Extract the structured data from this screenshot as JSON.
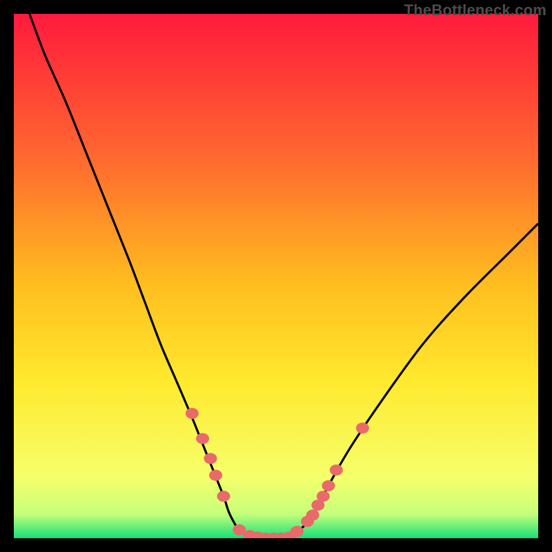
{
  "watermark": "TheBottleneck.com",
  "colors": {
    "top": "#ff1a3c",
    "mid1": "#ff6a2f",
    "mid2": "#ffbf1f",
    "mid3": "#ffe92e",
    "low": "#f6ff6a",
    "band_top": "#caff7a",
    "band_bottom": "#17e07a",
    "curve": "#000000",
    "dot_fill": "#e86a6a",
    "dot_stroke": "#c24848"
  },
  "chart_data": {
    "type": "line",
    "title": "",
    "xlabel": "",
    "ylabel": "",
    "xlim": [
      0,
      100
    ],
    "ylim": [
      0,
      100
    ],
    "series": [
      {
        "name": "bottleneck-curve",
        "x": [
          3,
          6,
          10,
          14,
          18,
          22,
          25,
          28,
          31,
          34,
          36,
          38,
          40,
          41,
          42,
          43,
          45,
          48,
          51,
          53,
          54,
          56,
          58,
          60,
          64,
          70,
          78,
          86,
          94,
          100
        ],
        "y": [
          100,
          92,
          83,
          73,
          63,
          53,
          45,
          37,
          30,
          23,
          18,
          13,
          8,
          5,
          3,
          1.5,
          0.4,
          0,
          0,
          0.3,
          1.2,
          3,
          6,
          10,
          17,
          26,
          37,
          46,
          54,
          60
        ]
      }
    ],
    "points": [
      {
        "x": 34.0,
        "y": 23.8
      },
      {
        "x": 36.0,
        "y": 19.0
      },
      {
        "x": 37.5,
        "y": 15.2
      },
      {
        "x": 38.5,
        "y": 12.0
      },
      {
        "x": 40.0,
        "y": 8.0
      },
      {
        "x": 43.0,
        "y": 1.6
      },
      {
        "x": 45.0,
        "y": 0.5
      },
      {
        "x": 46.5,
        "y": 0.2
      },
      {
        "x": 48.0,
        "y": 0.0
      },
      {
        "x": 49.5,
        "y": 0.0
      },
      {
        "x": 51.0,
        "y": 0.0
      },
      {
        "x": 52.5,
        "y": 0.2
      },
      {
        "x": 54.0,
        "y": 1.3
      },
      {
        "x": 56.0,
        "y": 3.2
      },
      {
        "x": 57.0,
        "y": 4.4
      },
      {
        "x": 58.0,
        "y": 6.3
      },
      {
        "x": 59.0,
        "y": 8.0
      },
      {
        "x": 60.0,
        "y": 10
      },
      {
        "x": 61.5,
        "y": 13.0
      },
      {
        "x": 66.5,
        "y": 21.0
      }
    ]
  }
}
